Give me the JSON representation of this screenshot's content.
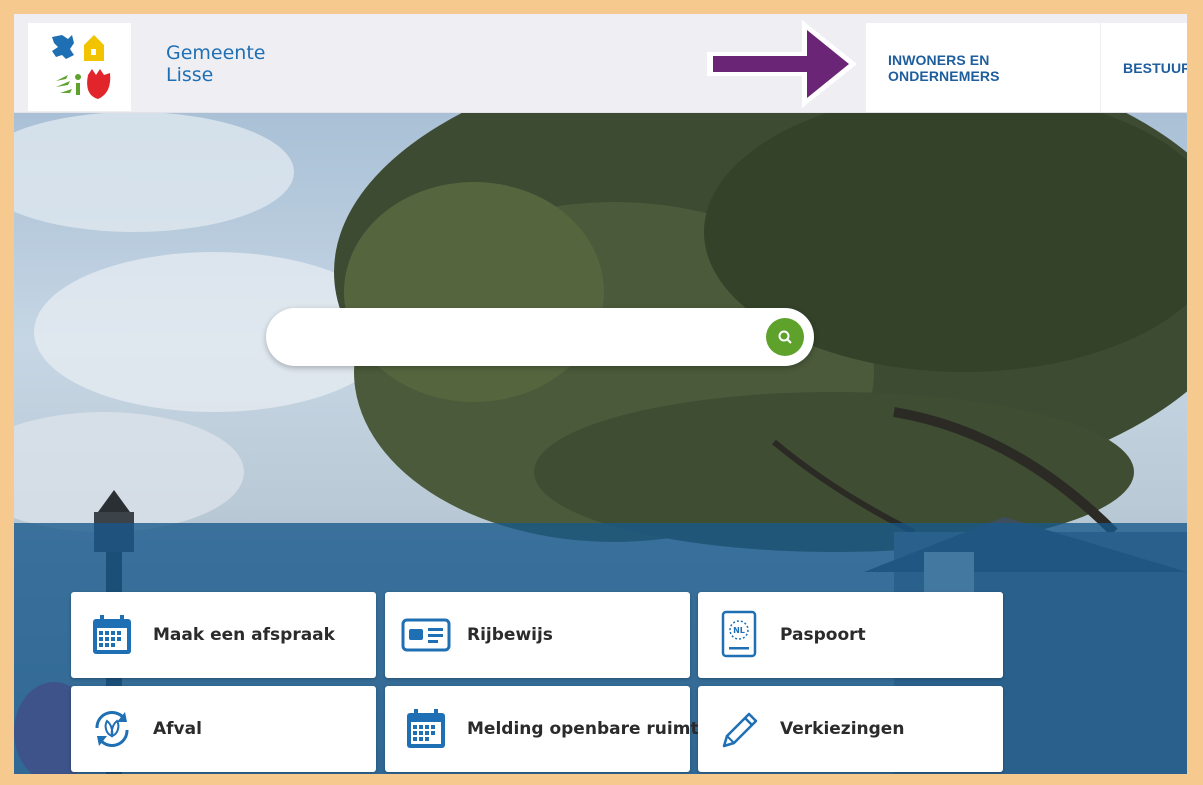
{
  "header": {
    "brand_line1": "Gemeente",
    "brand_line2": "Lisse",
    "nav": [
      "INWONERS EN ONDERNEMERS",
      "BESTUUR EN ORGANISATIE"
    ]
  },
  "search": {
    "placeholder": ""
  },
  "tiles": [
    {
      "label": "Maak een afspraak",
      "icon": "calendar-icon"
    },
    {
      "label": "Rijbewijs",
      "icon": "id-card-icon"
    },
    {
      "label": "Paspoort",
      "icon": "passport-icon"
    },
    {
      "label": "Afval",
      "icon": "recycle-icon"
    },
    {
      "label": "Melding openbare ruimte",
      "icon": "calendar-icon"
    },
    {
      "label": "Verkiezingen",
      "icon": "pencil-icon"
    }
  ],
  "colors": {
    "frame": "#f6c98f",
    "brand": "#1f6fb5",
    "nav_text": "#1f5e9e",
    "search_button": "#5fa22b",
    "band": "#17588c",
    "annotation_arrow": "#6b2576"
  }
}
